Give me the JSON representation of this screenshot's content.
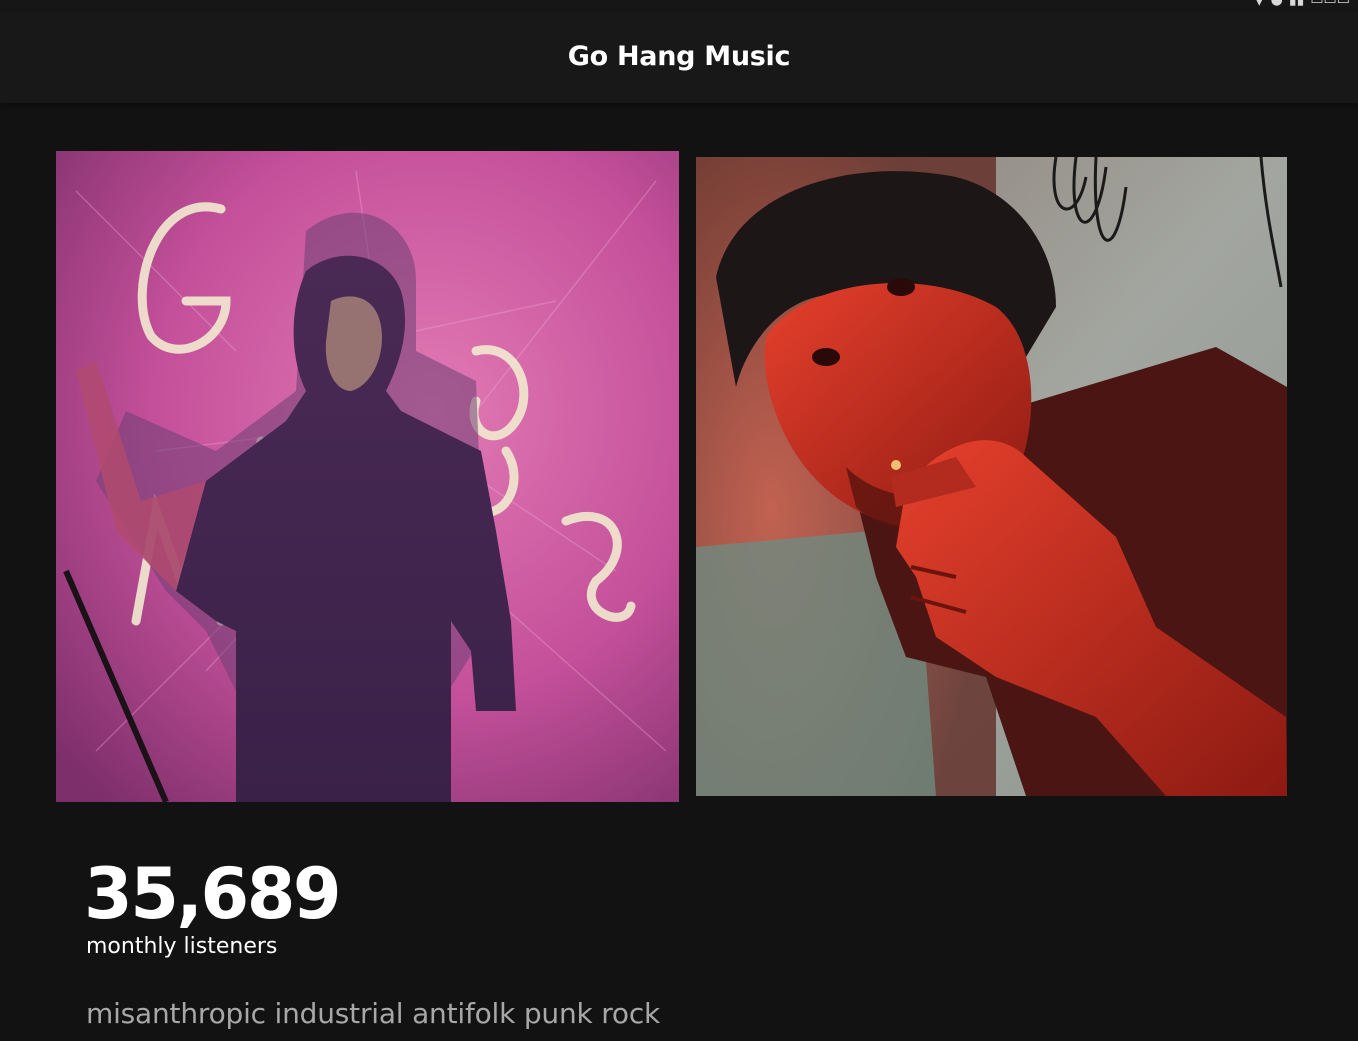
{
  "artist": {
    "name": "Go Hang Music",
    "monthly_listeners": "35,689",
    "monthly_listeners_label": "monthly listeners",
    "bio": "misanthropic industrial antifolk punk rock"
  },
  "images": [
    {
      "name": "artist-photo-pink",
      "dominant_color": "#c0508e"
    },
    {
      "name": "artist-photo-red",
      "dominant_color": "#b0241a"
    }
  ],
  "colors": {
    "background": "#121212",
    "header_bg": "#181818",
    "text_primary": "#ffffff",
    "text_secondary": "#a7a7a7"
  }
}
